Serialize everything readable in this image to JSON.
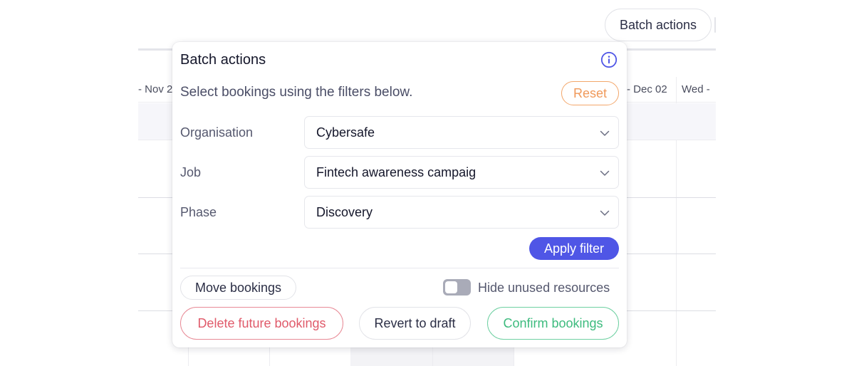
{
  "toolbar": {
    "batch_actions_label": "Batch actions"
  },
  "calendar": {
    "days": [
      "- Nov 2",
      "- Dec 02",
      "Wed -"
    ]
  },
  "batch_panel": {
    "title": "Batch actions",
    "info_icon": "info-circle-icon",
    "subtitle": "Select bookings using the filters below.",
    "reset_label": "Reset",
    "filters": {
      "organisation": {
        "label": "Organisation",
        "value": "Cybersafe"
      },
      "job": {
        "label": "Job",
        "value": "Fintech awareness campaig"
      },
      "phase": {
        "label": "Phase",
        "value": "Discovery"
      }
    },
    "apply_filter_label": "Apply filter",
    "move_bookings_label": "Move bookings",
    "hide_unused": {
      "label": "Hide unused resources",
      "enabled": false
    },
    "delete_future_label": "Delete future bookings",
    "revert_draft_label": "Revert to draft",
    "confirm_label": "Confirm bookings"
  },
  "colors": {
    "accent": "#4f56e6",
    "reset": "#f0995a",
    "danger": "#e05a6a",
    "success": "#3dbb7e"
  }
}
